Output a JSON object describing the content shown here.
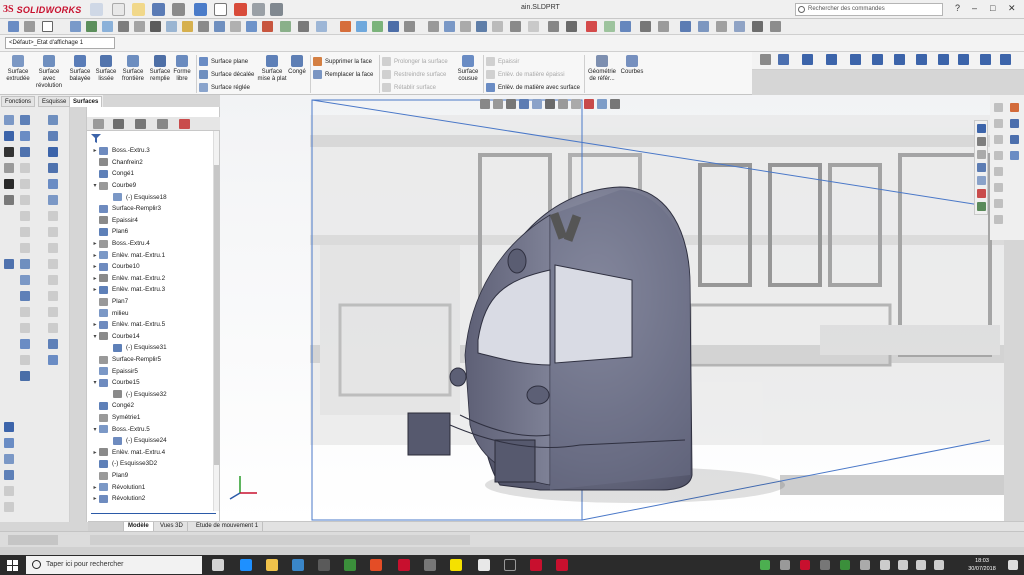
{
  "app": {
    "brand": "SOLIDWORKS",
    "document_title": "ain.SLDPRT"
  },
  "search": {
    "placeholder": "Rechercher des commandes"
  },
  "config": {
    "selected": "<Défaut>_Etat d'affichage 1"
  },
  "ribbon": {
    "large": [
      {
        "label": "Surface extrudée",
        "icon": "extruded-surface-icon"
      },
      {
        "label": "Surface avec révolution",
        "icon": "revolved-surface-icon"
      },
      {
        "label": "Surface balayée",
        "icon": "swept-surface-icon"
      },
      {
        "label": "Surface lissée",
        "icon": "lofted-surface-icon"
      },
      {
        "label": "Surface frontière",
        "icon": "boundary-surface-icon"
      },
      {
        "label": "Surface remplie",
        "icon": "filled-surface-icon"
      },
      {
        "label": "Forme libre",
        "icon": "freeform-icon"
      }
    ],
    "small_group1": [
      "Surface plane",
      "Surface décalée",
      "Surface réglée"
    ],
    "mise_a_plat": "Surface mise à plat",
    "conge": "Congé",
    "small_group2": [
      "Supprimer la face",
      "Remplacer la face"
    ],
    "disabled_group": [
      "Prolonger la surface",
      "Restreindre surface",
      "Rétablir surface"
    ],
    "couse": "Surface cousue",
    "small_group3": [
      "Epaissir",
      "Enlèv. de matière épaissi",
      "Enlèv. de matière avec surface"
    ],
    "geometrie": "Géométrie de référ...",
    "courbes": "Courbes"
  },
  "fm_tabs": [
    "Fonctions",
    "Esquisse",
    "Surfaces"
  ],
  "fm_active_tab": "Surfaces",
  "tree": [
    {
      "label": "Boss.-Extru.3",
      "expand": "▸",
      "indent": 0
    },
    {
      "label": "Chanfrein2",
      "expand": "",
      "indent": 0
    },
    {
      "label": "Congé1",
      "expand": "",
      "indent": 0
    },
    {
      "label": "Courbe9",
      "expand": "▾",
      "indent": 0
    },
    {
      "label": "(-) Esquisse18",
      "expand": "",
      "indent": 1
    },
    {
      "label": "Surface-Remplir3",
      "expand": "",
      "indent": 0
    },
    {
      "label": "Epaissir4",
      "expand": "",
      "indent": 0
    },
    {
      "label": "Plan6",
      "expand": "",
      "indent": 0
    },
    {
      "label": "Boss.-Extru.4",
      "expand": "▸",
      "indent": 0
    },
    {
      "label": "Enlèv. mat.-Extru.1",
      "expand": "▸",
      "indent": 0
    },
    {
      "label": "Courbe10",
      "expand": "▸",
      "indent": 0
    },
    {
      "label": "Enlèv. mat.-Extru.2",
      "expand": "▸",
      "indent": 0
    },
    {
      "label": "Enlèv. mat.-Extru.3",
      "expand": "▸",
      "indent": 0
    },
    {
      "label": "Plan7",
      "expand": "",
      "indent": 0
    },
    {
      "label": "milieu",
      "expand": "",
      "indent": 0
    },
    {
      "label": "Enlèv. mat.-Extru.5",
      "expand": "▸",
      "indent": 0
    },
    {
      "label": "Courbe14",
      "expand": "▾",
      "indent": 0
    },
    {
      "label": "(-) Esquisse31",
      "expand": "",
      "indent": 1
    },
    {
      "label": "Surface-Remplir5",
      "expand": "",
      "indent": 0
    },
    {
      "label": "Epaissir5",
      "expand": "",
      "indent": 0
    },
    {
      "label": "Courbe15",
      "expand": "▾",
      "indent": 0
    },
    {
      "label": "(-) Esquisse32",
      "expand": "",
      "indent": 1
    },
    {
      "label": "Congé2",
      "expand": "",
      "indent": 0
    },
    {
      "label": "Symétrie1",
      "expand": "",
      "indent": 0
    },
    {
      "label": "Boss.-Extru.5",
      "expand": "▾",
      "indent": 0
    },
    {
      "label": "(-) Esquisse24",
      "expand": "",
      "indent": 1
    },
    {
      "label": "Enlèv. mat.-Extru.4",
      "expand": "▸",
      "indent": 0
    },
    {
      "label": "(-) Esquisse3D2",
      "expand": "",
      "indent": 0
    },
    {
      "label": "Plan9",
      "expand": "",
      "indent": 0
    },
    {
      "label": "Révolution1",
      "expand": "▸",
      "indent": 0
    },
    {
      "label": "Révolution2",
      "expand": "▸",
      "indent": 0
    }
  ],
  "bottom_tabs": [
    "Modèle",
    "Vues 3D",
    "Etude de mouvement 1"
  ],
  "bottom_active": "Modèle",
  "taskbar": {
    "search_placeholder": "Taper ici pour rechercher",
    "time": "18:03",
    "date": "30/07/2018"
  },
  "colors": {
    "accent": "#2b5aa8",
    "brand": "#c8102e",
    "model": "#6c6f86"
  }
}
